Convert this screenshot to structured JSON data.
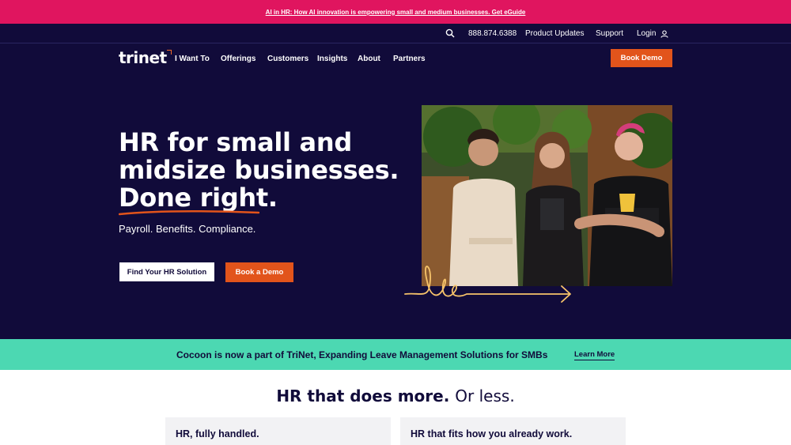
{
  "promo": {
    "text": "AI in HR: How AI innovation is empowering small and medium businesses. Get eGuide"
  },
  "utility": {
    "phone": "888.874.6388",
    "product_updates": "Product Updates",
    "support": "Support",
    "login": "Login"
  },
  "nav": {
    "logo": "trinet",
    "items": [
      "I Want To",
      "Offerings",
      "Customers",
      "Insights",
      "About",
      "Partners"
    ],
    "cta": "Book Demo"
  },
  "hero": {
    "line1": "HR for small and",
    "line2": "midsize businesses.",
    "line3": "Done right.",
    "subtitle": "Payroll. Benefits. Compliance.",
    "primary_button": "Find Your HR Solution",
    "secondary_button": "Book a Demo"
  },
  "announcement": {
    "message": "Cocoon is now a part of TriNet, Expanding Leave Management Solutions for SMBs",
    "link": "Learn More"
  },
  "section": {
    "title_bold": "HR that does more.",
    "title_light": "Or less."
  },
  "cards": [
    {
      "title": "HR, fully handled."
    },
    {
      "title": "HR that fits how you already work."
    }
  ],
  "colors": {
    "navy": "#110b3a",
    "pink": "#e0155f",
    "orange": "#e2541b",
    "teal": "#4cd8b2"
  }
}
